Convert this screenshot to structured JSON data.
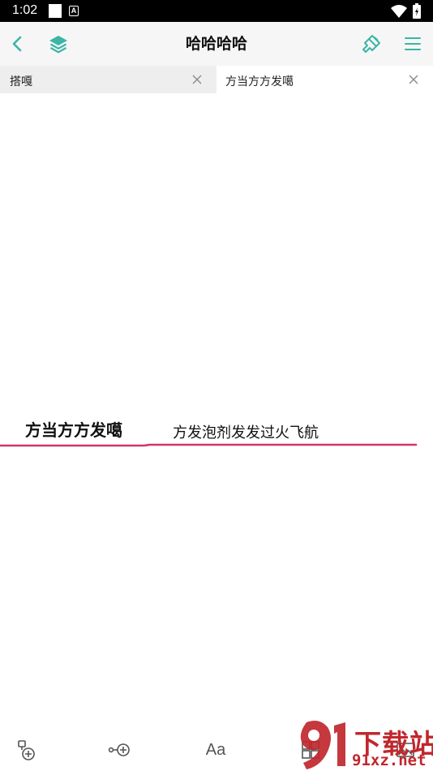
{
  "status_bar": {
    "time": "1:02",
    "notification_icon": "a-letter-icon"
  },
  "toolbar": {
    "title": "哈哈哈哈",
    "back_icon": "chevron-left-icon",
    "layers_icon": "layers-icon",
    "style_icon": "paint-brush-icon",
    "menu_icon": "hamburger-menu-icon",
    "accent_color": "#3bb5a6"
  },
  "tabs": [
    {
      "label": "搭嘎",
      "active": false
    },
    {
      "label": "方当方方发噶",
      "active": true
    }
  ],
  "canvas": {
    "root_node": "方当方方发噶",
    "child_node": "方发泡剂发发过火飞航",
    "connector_color": "#d0346e"
  },
  "bottom_bar": {
    "items": [
      {
        "icon": "add-topic-icon"
      },
      {
        "icon": "add-node-icon"
      },
      {
        "label": "Aa",
        "icon": "text-format-icon"
      },
      {
        "icon": "grid-layout-icon"
      },
      {
        "icon": "picture-icon"
      }
    ]
  },
  "watermark": {
    "brand": "下载站",
    "url": "91xz.net"
  }
}
